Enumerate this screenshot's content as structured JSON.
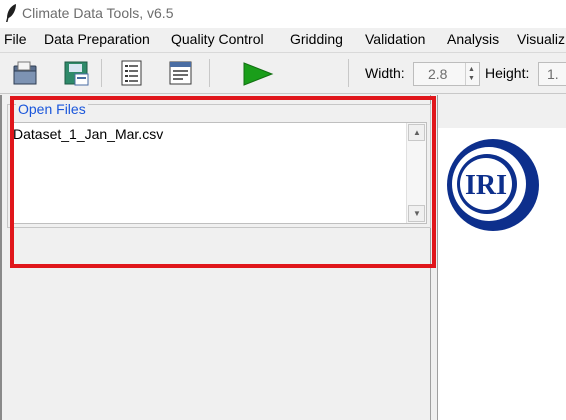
{
  "window": {
    "title": "Climate Data Tools, v6.5",
    "icon": "feather-icon"
  },
  "menu": {
    "items": [
      "File",
      "Data Preparation",
      "Quality Control",
      "Gridding",
      "Validation",
      "Analysis",
      "Visualiz"
    ]
  },
  "toolbar": {
    "buttons": [
      {
        "icon": "open-folder-icon"
      },
      {
        "icon": "save-icon"
      },
      {
        "icon": "document-list-icon"
      },
      {
        "icon": "document-edit-icon"
      },
      {
        "icon": "run-play-icon",
        "color": "#1a9e1a"
      }
    ],
    "width_label": "Width:",
    "width_value": "2.8",
    "height_label": "Height:",
    "height_value": "1."
  },
  "open_files": {
    "legend": "Open Files",
    "files": [
      "Dataset_1_Jan_Mar.csv"
    ]
  },
  "logo": {
    "text": "IRI",
    "color": "#0d2f8c"
  },
  "colors": {
    "highlight": "#e0161b",
    "legend_text": "#1a56db"
  }
}
